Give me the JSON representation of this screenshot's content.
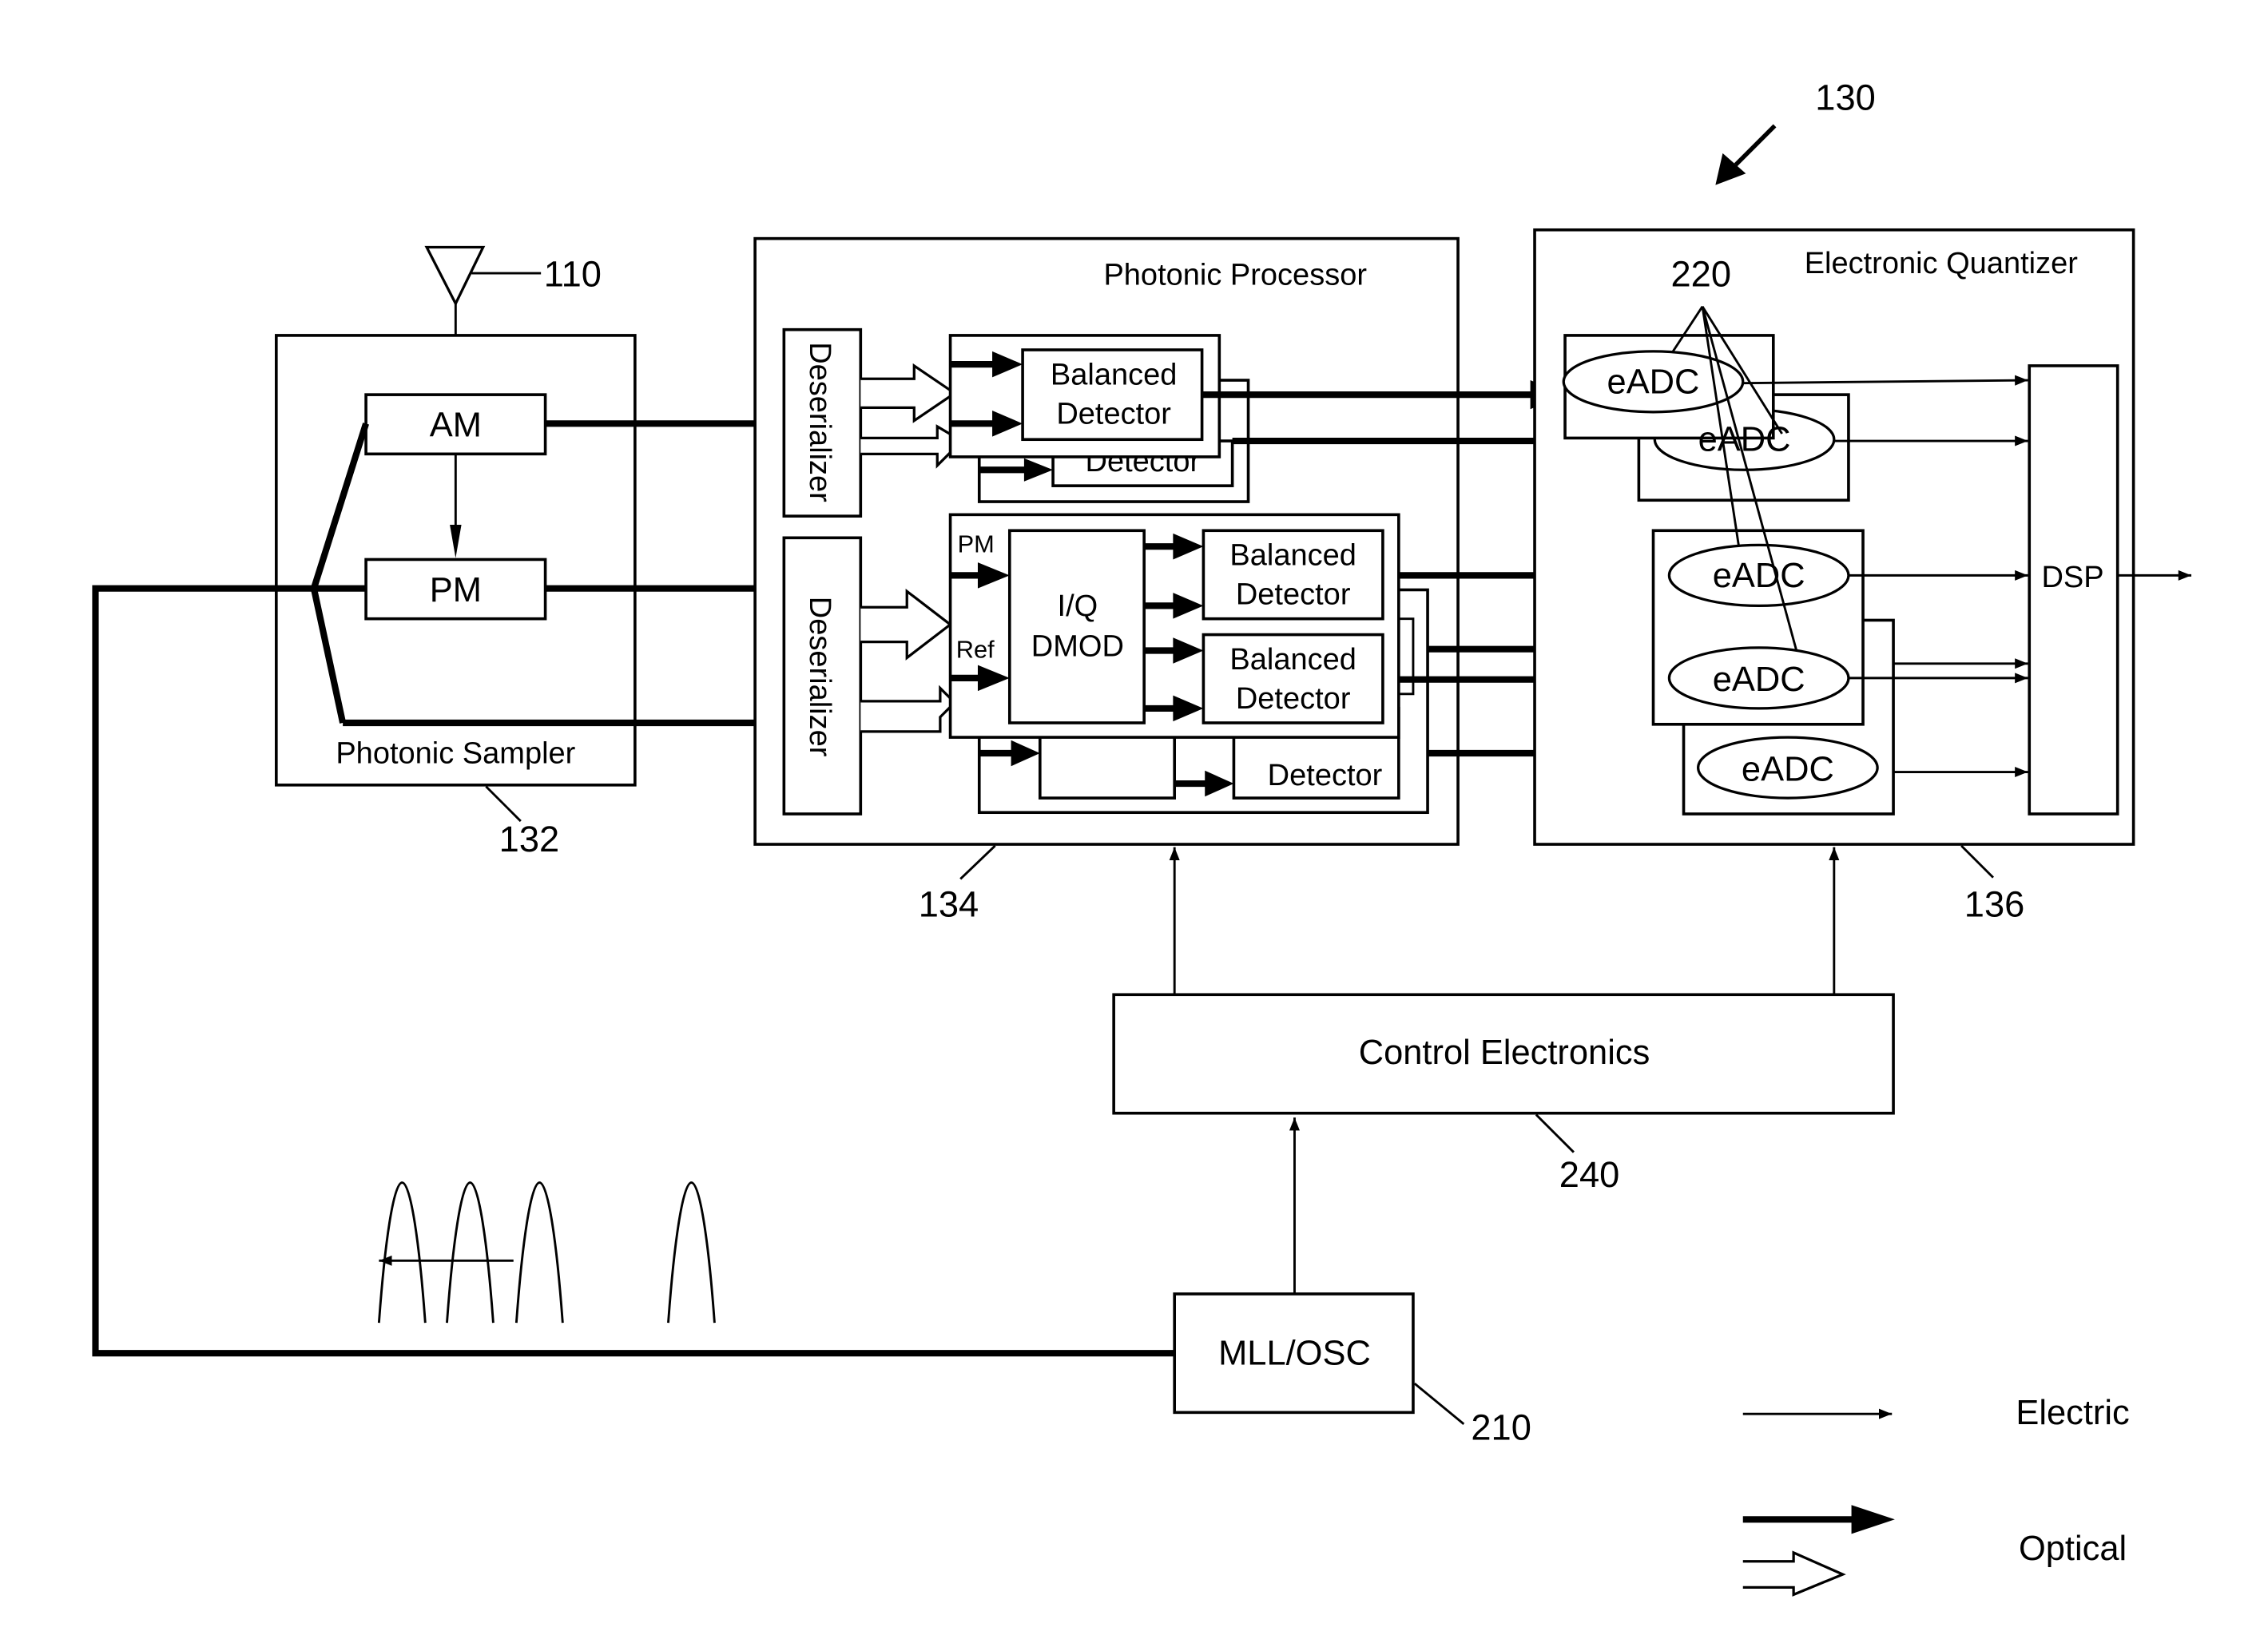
{
  "figure": {
    "reference_number": "130",
    "colors": {
      "line": "#000000",
      "background": "#ffffff"
    }
  },
  "antenna": {
    "ref": "110"
  },
  "photonic_sampler": {
    "title": "Photonic Sampler",
    "ref": "132",
    "am_label": "AM",
    "pm_label": "PM"
  },
  "photonic_processor": {
    "title": "Photonic Processor",
    "ref": "134",
    "deserializer_label": "Deserializer",
    "balanced_detector_line1": "Balanced",
    "balanced_detector_line2": "Detector",
    "iq_line1": "I/Q",
    "iq_line2": "DMOD",
    "pm_input_label": "PM",
    "ref_input_label": "Ref"
  },
  "electronic_quantizer": {
    "title": "Electronic Quantizer",
    "ref": "136",
    "eadc_ref": "220",
    "eadc_label": "eADC",
    "dsp_label": "DSP"
  },
  "control_electronics": {
    "title": "Control Electronics",
    "ref": "240"
  },
  "mll": {
    "title": "MLL/OSC",
    "ref": "210"
  },
  "legend": {
    "items": [
      {
        "label": "Electric",
        "style": "thin-arrow"
      },
      {
        "label": "Optical",
        "style": "thick-arrow-and-hollow-arrow"
      }
    ]
  }
}
